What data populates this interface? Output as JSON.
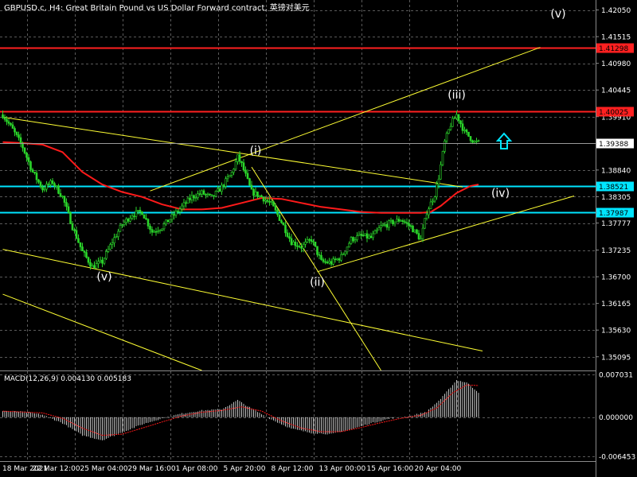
{
  "header": {
    "symbol_info": "GBPUSD.c, H4:  Great Britain Pound vs US Dollar Forward contract, 英镑对美元"
  },
  "price_axis": {
    "ticks": [
      "1.42050",
      "1.41515",
      "1.40980",
      "1.40445",
      "1.39910",
      "1.39375",
      "1.38840",
      "1.38305",
      "1.37777",
      "1.37235",
      "1.36700",
      "1.36165",
      "1.35630",
      "1.35095"
    ]
  },
  "time_axis": {
    "labels": [
      "18 Mar 2021",
      "22 Mar 12:00",
      "25 Mar 04:00",
      "29 Mar 16:00",
      "1 Apr 08:00",
      "5 Apr 20:00",
      "8 Apr 12:00",
      "13 Apr 00:00",
      "15 Apr 16:00",
      "20 Apr 04:00"
    ]
  },
  "levels": [
    {
      "label": "1.41298",
      "color": "#ff2020"
    },
    {
      "label": "1.40025",
      "color": "#ff2020"
    },
    {
      "label": "1.38521",
      "color": "#00e5ff"
    },
    {
      "label": "1.37987",
      "color": "#00e5ff"
    }
  ],
  "current_price": {
    "label": "1.39388"
  },
  "wave_labels": [
    "(v)",
    "(i)",
    "(ii)",
    "(iii)",
    "(iv)",
    "(v)"
  ],
  "macd": {
    "title": "MACD(12,26,9) 0.004130 0.005183",
    "ticks": [
      "0.007031",
      "0.000000",
      "-0.006453"
    ]
  },
  "colors": {
    "background": "#000000",
    "grid": "#5a5a5a",
    "candles": "#2bd62b",
    "moving_average": "#ff1a1a",
    "trendlines": "#ffff33",
    "macd_histogram": "#c0c0c0",
    "macd_signal": "#ff1a1a",
    "arrow": "#00e5ff"
  },
  "icons": {
    "signal_arrow": "up-arrow-icon"
  },
  "chart_data": {
    "type": "candlestick",
    "title": "GBPUSD.c, H4",
    "timeframe": "H4",
    "ylim": [
      1.3482,
      1.4225
    ],
    "close_path": [
      {
        "i": 0,
        "c": 1.3995
      },
      {
        "i": 5,
        "c": 1.3965
      },
      {
        "i": 10,
        "c": 1.393
      },
      {
        "i": 15,
        "c": 1.388
      },
      {
        "i": 20,
        "c": 1.3846
      },
      {
        "i": 25,
        "c": 1.386
      },
      {
        "i": 30,
        "c": 1.383
      },
      {
        "i": 35,
        "c": 1.377
      },
      {
        "i": 40,
        "c": 1.372
      },
      {
        "i": 45,
        "c": 1.369
      },
      {
        "i": 50,
        "c": 1.37
      },
      {
        "i": 55,
        "c": 1.374
      },
      {
        "i": 60,
        "c": 1.3775
      },
      {
        "i": 65,
        "c": 1.3795
      },
      {
        "i": 70,
        "c": 1.38
      },
      {
        "i": 75,
        "c": 1.376
      },
      {
        "i": 80,
        "c": 1.377
      },
      {
        "i": 85,
        "c": 1.379
      },
      {
        "i": 90,
        "c": 1.381
      },
      {
        "i": 95,
        "c": 1.383
      },
      {
        "i": 100,
        "c": 1.3838
      },
      {
        "i": 105,
        "c": 1.3828
      },
      {
        "i": 110,
        "c": 1.385
      },
      {
        "i": 115,
        "c": 1.3878
      },
      {
        "i": 118,
        "c": 1.391
      },
      {
        "i": 120,
        "c": 1.3895
      },
      {
        "i": 125,
        "c": 1.384
      },
      {
        "i": 130,
        "c": 1.383
      },
      {
        "i": 135,
        "c": 1.3815
      },
      {
        "i": 140,
        "c": 1.378
      },
      {
        "i": 145,
        "c": 1.374
      },
      {
        "i": 150,
        "c": 1.373
      },
      {
        "i": 155,
        "c": 1.3745
      },
      {
        "i": 160,
        "c": 1.37
      },
      {
        "i": 165,
        "c": 1.3698
      },
      {
        "i": 170,
        "c": 1.371
      },
      {
        "i": 175,
        "c": 1.3745
      },
      {
        "i": 180,
        "c": 1.3752
      },
      {
        "i": 185,
        "c": 1.3748
      },
      {
        "i": 190,
        "c": 1.377
      },
      {
        "i": 195,
        "c": 1.3778
      },
      {
        "i": 200,
        "c": 1.3785
      },
      {
        "i": 205,
        "c": 1.377
      },
      {
        "i": 210,
        "c": 1.3745
      },
      {
        "i": 213,
        "c": 1.38
      },
      {
        "i": 217,
        "c": 1.3835
      },
      {
        "i": 219,
        "c": 1.387
      },
      {
        "i": 222,
        "c": 1.394
      },
      {
        "i": 225,
        "c": 1.3975
      },
      {
        "i": 228,
        "c": 1.3995
      },
      {
        "i": 232,
        "c": 1.396
      },
      {
        "i": 237,
        "c": 1.394
      },
      {
        "i": 239,
        "c": 1.3939
      }
    ],
    "moving_average": [
      {
        "i": 0,
        "v": 1.394
      },
      {
        "i": 10,
        "v": 1.3938
      },
      {
        "i": 20,
        "v": 1.3935
      },
      {
        "i": 30,
        "v": 1.392
      },
      {
        "i": 40,
        "v": 1.388
      },
      {
        "i": 50,
        "v": 1.3855
      },
      {
        "i": 60,
        "v": 1.384
      },
      {
        "i": 70,
        "v": 1.383
      },
      {
        "i": 80,
        "v": 1.3815
      },
      {
        "i": 90,
        "v": 1.3805
      },
      {
        "i": 100,
        "v": 1.3805
      },
      {
        "i": 110,
        "v": 1.3808
      },
      {
        "i": 120,
        "v": 1.3818
      },
      {
        "i": 130,
        "v": 1.3828
      },
      {
        "i": 140,
        "v": 1.3826
      },
      {
        "i": 150,
        "v": 1.3818
      },
      {
        "i": 160,
        "v": 1.381
      },
      {
        "i": 170,
        "v": 1.3805
      },
      {
        "i": 180,
        "v": 1.38
      },
      {
        "i": 190,
        "v": 1.3798
      },
      {
        "i": 200,
        "v": 1.3798
      },
      {
        "i": 210,
        "v": 1.3798
      },
      {
        "i": 215,
        "v": 1.38
      },
      {
        "i": 220,
        "v": 1.3812
      },
      {
        "i": 228,
        "v": 1.3838
      },
      {
        "i": 235,
        "v": 1.3852
      },
      {
        "i": 239,
        "v": 1.3855
      }
    ],
    "horizontal_levels": [
      1.41298,
      1.40025,
      1.38521,
      1.37987
    ],
    "trendlines": [
      {
        "from": {
          "i": 0,
          "p": 1.399
        },
        "to": {
          "i": 231,
          "p": 1.385
        }
      },
      {
        "from": {
          "i": 74,
          "p": 1.3842
        },
        "to": {
          "i": 270,
          "p": 1.413
        }
      },
      {
        "from": {
          "i": 158,
          "p": 1.368
        },
        "to": {
          "i": 287,
          "p": 1.3832
        }
      },
      {
        "from": {
          "i": 0,
          "p": 1.3725
        },
        "to": {
          "i": 241,
          "p": 1.3521
        }
      },
      {
        "from": {
          "i": 0,
          "p": 1.3635
        },
        "to": {
          "i": 100,
          "p": 1.3482
        }
      },
      {
        "from": {
          "i": 125,
          "p": 1.389
        },
        "to": {
          "i": 190,
          "p": 1.3482
        }
      }
    ],
    "current_price": 1.39388,
    "macd": {
      "params": "12,26,9",
      "macd": 0.00413,
      "signal": 0.005183,
      "ylim": [
        -0.006453,
        0.007031
      ],
      "histogram_path": [
        {
          "i": 0,
          "v": 0.001
        },
        {
          "i": 10,
          "v": 0.0009
        },
        {
          "i": 20,
          "v": 0.0004
        },
        {
          "i": 30,
          "v": -0.001
        },
        {
          "i": 40,
          "v": -0.003
        },
        {
          "i": 50,
          "v": -0.0038
        },
        {
          "i": 60,
          "v": -0.0025
        },
        {
          "i": 70,
          "v": -0.0012
        },
        {
          "i": 80,
          "v": -0.0002
        },
        {
          "i": 90,
          "v": 0.0006
        },
        {
          "i": 100,
          "v": 0.0011
        },
        {
          "i": 110,
          "v": 0.0013
        },
        {
          "i": 118,
          "v": 0.0028
        },
        {
          "i": 125,
          "v": 0.0014
        },
        {
          "i": 135,
          "v": -0.0004
        },
        {
          "i": 145,
          "v": -0.0019
        },
        {
          "i": 155,
          "v": -0.0026
        },
        {
          "i": 165,
          "v": -0.0028
        },
        {
          "i": 175,
          "v": -0.002
        },
        {
          "i": 185,
          "v": -0.001
        },
        {
          "i": 195,
          "v": -0.0002
        },
        {
          "i": 205,
          "v": 0.0002
        },
        {
          "i": 213,
          "v": 0.0009
        },
        {
          "i": 220,
          "v": 0.003
        },
        {
          "i": 228,
          "v": 0.0061
        },
        {
          "i": 233,
          "v": 0.0057
        },
        {
          "i": 239,
          "v": 0.0041
        }
      ],
      "signal_path": [
        {
          "i": 0,
          "v": 0.001
        },
        {
          "i": 20,
          "v": 0.0007
        },
        {
          "i": 30,
          "v": -0.0002
        },
        {
          "i": 40,
          "v": -0.0018
        },
        {
          "i": 50,
          "v": -0.003
        },
        {
          "i": 60,
          "v": -0.0028
        },
        {
          "i": 70,
          "v": -0.0018
        },
        {
          "i": 80,
          "v": -0.0008
        },
        {
          "i": 90,
          "v": 0.0002
        },
        {
          "i": 100,
          "v": 0.0008
        },
        {
          "i": 110,
          "v": 0.0011
        },
        {
          "i": 120,
          "v": 0.0017
        },
        {
          "i": 130,
          "v": 0.001
        },
        {
          "i": 140,
          "v": -0.0006
        },
        {
          "i": 150,
          "v": -0.0018
        },
        {
          "i": 160,
          "v": -0.0024
        },
        {
          "i": 170,
          "v": -0.0024
        },
        {
          "i": 180,
          "v": -0.0017
        },
        {
          "i": 190,
          "v": -0.0009
        },
        {
          "i": 200,
          "v": -0.0002
        },
        {
          "i": 210,
          "v": 0.0003
        },
        {
          "i": 218,
          "v": 0.0015
        },
        {
          "i": 226,
          "v": 0.004
        },
        {
          "i": 233,
          "v": 0.0053
        },
        {
          "i": 239,
          "v": 0.0052
        }
      ]
    }
  }
}
